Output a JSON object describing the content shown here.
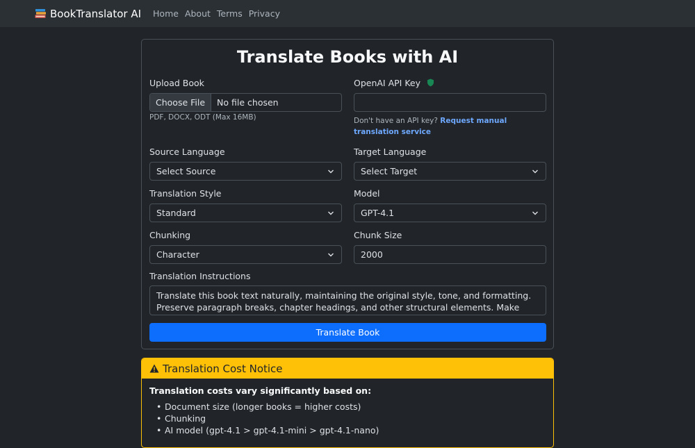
{
  "navbar": {
    "brand": "BookTranslator AI",
    "links": [
      "Home",
      "About",
      "Terms",
      "Privacy"
    ]
  },
  "form": {
    "title": "Translate Books with AI",
    "upload_label": "Upload Book",
    "file_button": "Choose File",
    "file_status": "No file chosen",
    "file_hint": "PDF, DOCX, ODT (Max 16MB)",
    "api_key_label": "OpenAI API Key",
    "api_key_value": "",
    "api_hint_prefix": "Don't have an API key? ",
    "api_hint_link": "Request manual translation service",
    "source_label": "Source Language",
    "source_value": "Select Source",
    "target_label": "Target Language",
    "target_value": "Select Target",
    "style_label": "Translation Style",
    "style_value": "Standard",
    "model_label": "Model",
    "model_value": "GPT-4.1",
    "chunking_label": "Chunking",
    "chunking_value": "Character",
    "chunk_size_label": "Chunk Size",
    "chunk_size_value": "2000",
    "instructions_label": "Translation Instructions",
    "instructions_value": "Translate this book text naturally, maintaining the original style, tone, and formatting. Preserve paragraph breaks, chapter headings, and other structural elements. Make sure character names,",
    "submit_label": "Translate Book"
  },
  "notice": {
    "title": "Translation Cost Notice",
    "intro": "Translation costs vary significantly based on:",
    "items": [
      "Document size (longer books = higher costs)",
      "Chunking",
      "AI model (gpt-4.1 > gpt-4.1-mini > gpt-4.1-nano)"
    ]
  },
  "colors": {
    "background": "#212529",
    "navbar": "#2b3035",
    "primary": "#0d6efd",
    "warning": "#ffc107",
    "link": "#6ea8fe",
    "shield": "#198754"
  }
}
